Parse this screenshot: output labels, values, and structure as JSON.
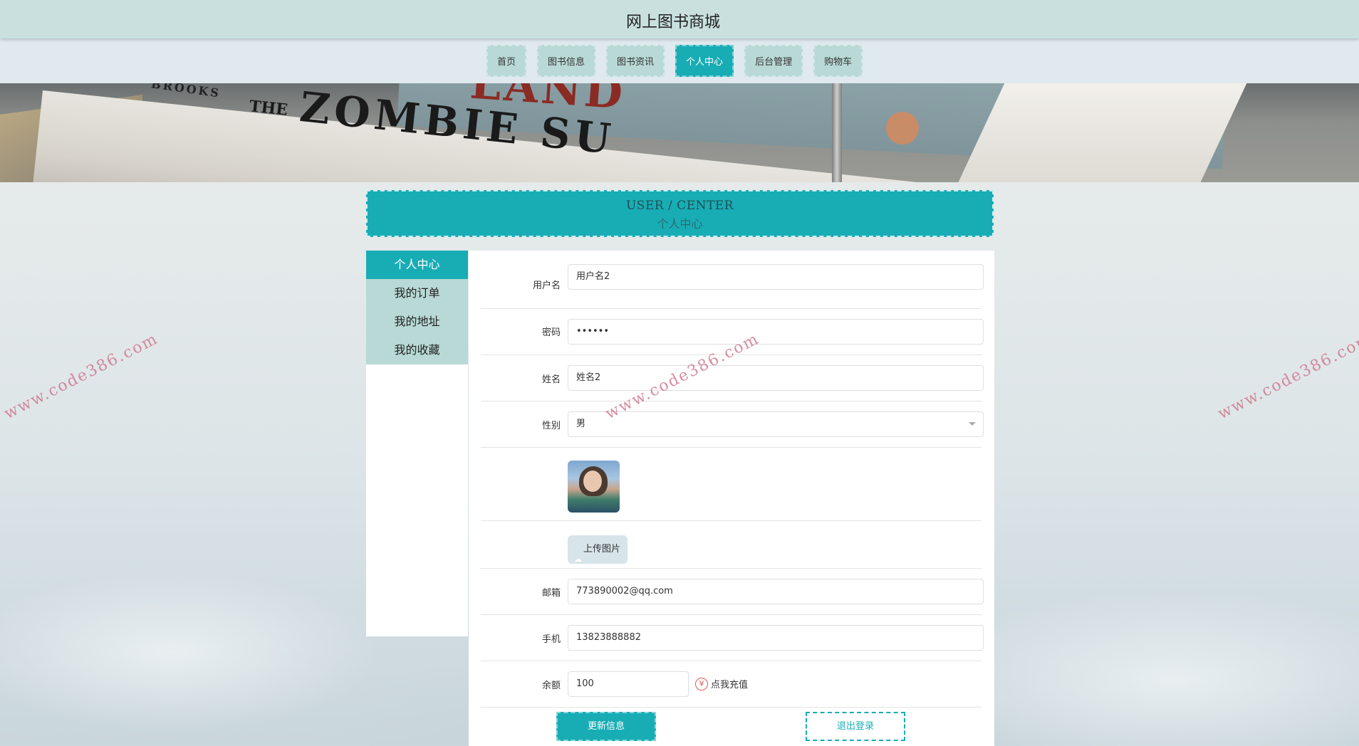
{
  "site": {
    "title": "网上图书商城"
  },
  "nav": {
    "items": [
      "首页",
      "图书信息",
      "图书资讯",
      "个人中心",
      "后台管理",
      "购物车"
    ],
    "active": "个人中心"
  },
  "banner": {
    "texts": [
      "BROOKS",
      "THE",
      "ZOMBIE SU",
      "LAND"
    ]
  },
  "user_center": {
    "title_en": "USER / CENTER",
    "title_zh": "个人中心"
  },
  "sidebar": {
    "items": [
      {
        "label": "个人中心",
        "active": true
      },
      {
        "label": "我的订单",
        "active": false
      },
      {
        "label": "我的地址",
        "active": false
      },
      {
        "label": "我的收藏",
        "active": false
      }
    ]
  },
  "form": {
    "username": {
      "label": "用户名",
      "value": "用户名2"
    },
    "password": {
      "label": "密码",
      "value": "••••••"
    },
    "name": {
      "label": "姓名",
      "value": "姓名2"
    },
    "gender": {
      "label": "性别",
      "value": "男"
    },
    "upload": {
      "label": "上传图片"
    },
    "email": {
      "label": "邮箱",
      "value": "773890002@qq.com"
    },
    "phone": {
      "label": "手机",
      "value": "13823888882"
    },
    "balance": {
      "label": "余额",
      "value": "100",
      "recharge_label": "点我充值",
      "recharge_icon": "yen-icon"
    }
  },
  "buttons": {
    "update": "更新信息",
    "logout": "退出登录"
  },
  "watermark": {
    "text": "www.code386.com"
  },
  "colors": {
    "primary": "#18adb5",
    "nav_bg": "#b8d9d5",
    "topbar": "#c9e0df"
  }
}
